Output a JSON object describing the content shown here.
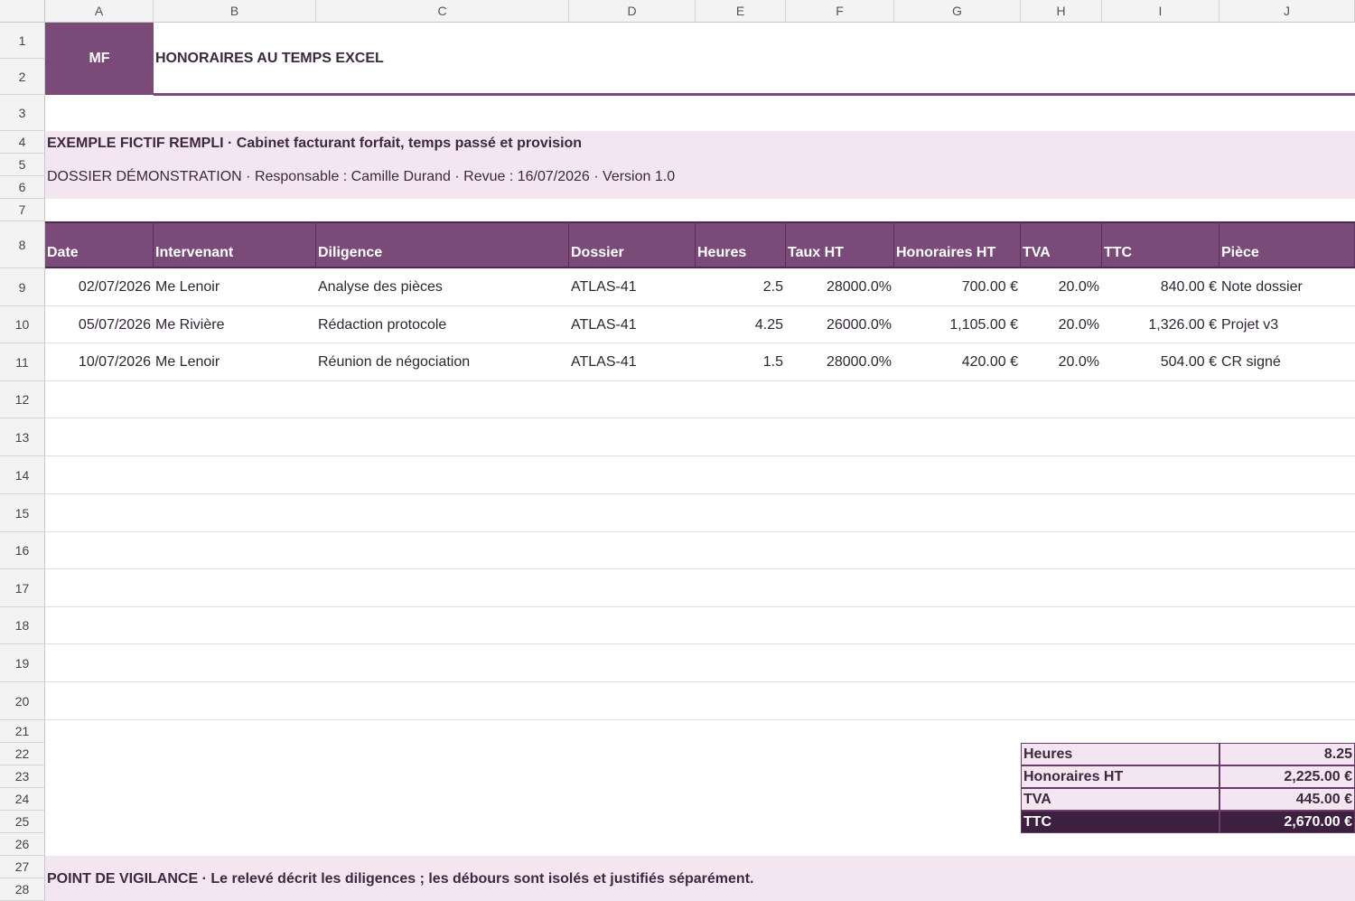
{
  "columns": [
    "A",
    "B",
    "C",
    "D",
    "E",
    "F",
    "G",
    "H",
    "I",
    "J"
  ],
  "rows": [
    "1",
    "2",
    "3",
    "4",
    "5",
    "6",
    "7",
    "8",
    "9",
    "10",
    "11",
    "12",
    "13",
    "14",
    "15",
    "16",
    "17",
    "18",
    "19",
    "20",
    "21",
    "22",
    "23",
    "24",
    "25",
    "26",
    "27",
    "28"
  ],
  "logo": "MF",
  "title": "HONORAIRES AU TEMPS EXCEL",
  "subtitle": "EXEMPLE FICTIF REMPLI · Cabinet facturant forfait, temps passé et provision",
  "info": "DOSSIER DÉMONSTRATION · Responsable : Camille Durand · Revue : 16/07/2026 · Version 1.0",
  "table": {
    "headers": [
      "Date",
      "Intervenant",
      "Diligence",
      "Dossier",
      "Heures",
      "Taux HT",
      "Honoraires HT",
      "TVA",
      "TTC",
      "Pièce"
    ],
    "rows": [
      [
        "02/07/2026",
        "Me Lenoir",
        "Analyse des pièces",
        "ATLAS-41",
        "2.5",
        "28000.0%",
        "700.00 €",
        "20.0%",
        "840.00 €",
        "Note dossier"
      ],
      [
        "05/07/2026",
        "Me Rivière",
        "Rédaction protocole",
        "ATLAS-41",
        "4.25",
        "26000.0%",
        "1,105.00 €",
        "20.0%",
        "1,326.00 €",
        "Projet v3"
      ],
      [
        "10/07/2026",
        "Me Lenoir",
        "Réunion de négociation",
        "ATLAS-41",
        "1.5",
        "28000.0%",
        "420.00 €",
        "20.0%",
        "504.00 €",
        "CR signé"
      ]
    ]
  },
  "summary": [
    {
      "label": "Heures",
      "value": "8.25"
    },
    {
      "label": "Honoraires HT",
      "value": "2,225.00 €"
    },
    {
      "label": "TVA",
      "value": "445.00 €"
    },
    {
      "label": "TTC",
      "value": "2,670.00 €"
    }
  ],
  "note": "POINT DE VIGILANCE · Le relevé décrit les diligences ; les débours sont isolés et justifiés séparément.",
  "colors": {
    "accent": "#7a4b78",
    "band": "#f3e6f1",
    "dark": "#3d2040"
  }
}
